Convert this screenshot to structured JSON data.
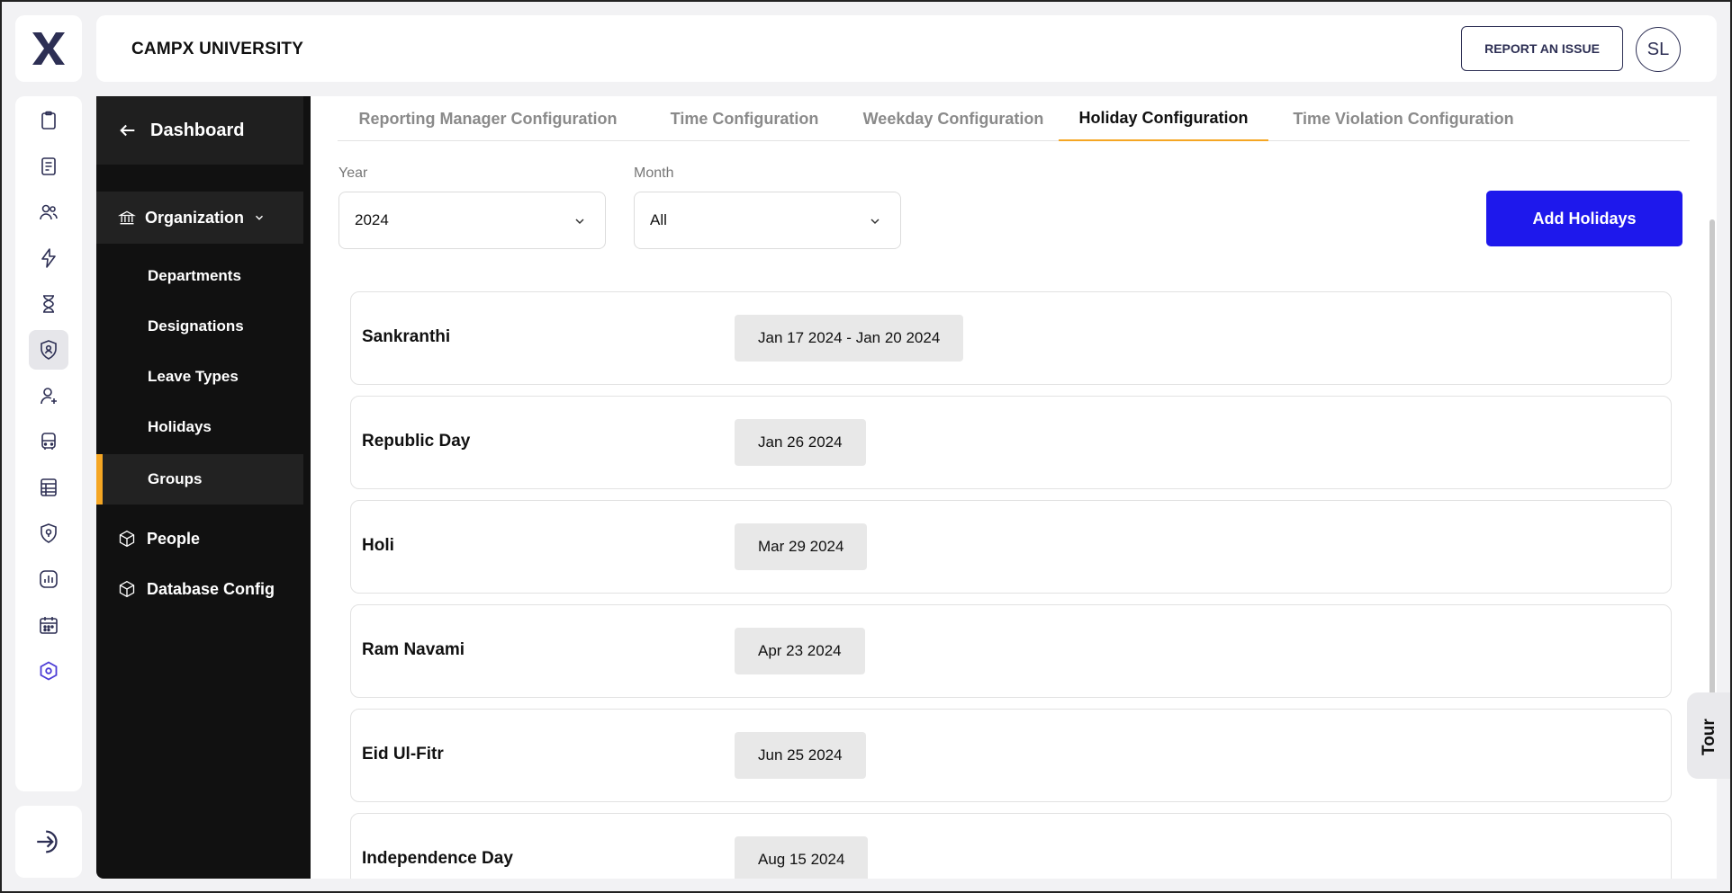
{
  "header": {
    "title": "CAMPX UNIVERSITY",
    "report_label": "REPORT AN ISSUE",
    "avatar_initials": "SL"
  },
  "rail": {
    "icons": [
      "clipboard-icon",
      "notebook-icon",
      "users-icon",
      "lightning-icon",
      "hourglass-icon",
      "shield-user-icon",
      "user-plus-icon",
      "bus-icon",
      "spreadsheet-icon",
      "shield-location-icon",
      "analytics-icon",
      "calendar-icon",
      "hexagon-settings-icon"
    ],
    "active_index": 5,
    "logout_icon": "logout-icon"
  },
  "sidebar": {
    "dashboard_label": "Dashboard",
    "organization_label": "Organization",
    "org_items": [
      {
        "label": "Departments"
      },
      {
        "label": "Designations"
      },
      {
        "label": "Leave Types"
      },
      {
        "label": "Holidays"
      },
      {
        "label": "Groups"
      }
    ],
    "active_item": "Groups",
    "people_label": "People",
    "database_label": "Database Config"
  },
  "tabs": [
    {
      "label": "Reporting Manager Configuration"
    },
    {
      "label": "Time Configuration"
    },
    {
      "label": "Weekday Configuration"
    },
    {
      "label": "Holiday Configuration"
    },
    {
      "label": "Time Violation Configuration"
    }
  ],
  "active_tab": "Holiday Configuration",
  "filters": {
    "year_label": "Year",
    "year_value": "2024",
    "month_label": "Month",
    "month_value": "All"
  },
  "add_button_label": "Add Holidays",
  "holidays": [
    {
      "name": "Sankranthi",
      "date": "Jan 17 2024 - Jan 20 2024"
    },
    {
      "name": "Republic Day",
      "date": "Jan 26 2024"
    },
    {
      "name": "Holi",
      "date": "Mar 29 2024"
    },
    {
      "name": "Ram Navami",
      "date": "Apr 23 2024"
    },
    {
      "name": "Eid Ul-Fitr",
      "date": "Jun 25 2024"
    },
    {
      "name": "Independence Day",
      "date": "Aug 15 2024"
    }
  ],
  "tour_label": "Tour",
  "colors": {
    "accent": "#f5a623",
    "primary_button": "#1e18ec",
    "sidebar_bg": "#111111",
    "brand_navy": "#2d2f54"
  }
}
